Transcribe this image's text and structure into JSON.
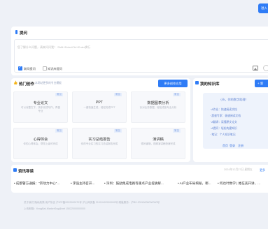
{
  "top": {
    "action_label": "进入"
  },
  "question": {
    "title": "提问",
    "placeholder": "您了解什么问题，请来问问我！ Shift+Enter/Ctrl+Enter换行",
    "options": [
      {
        "label": "联网提问",
        "checked": true
      },
      {
        "label": "知识库提问",
        "checked": false
      }
    ],
    "icons": [
      "image-icon",
      "circle-action-icon"
    ]
  },
  "hot": {
    "title": "热门创作",
    "subtitle": "本网站更多的专业模板",
    "more_label": "更多创作应用",
    "templates": [
      {
        "tag": "常见",
        "title": "专业论文",
        "desc": "可以对整文下，快手完成写作，再做专业"
      },
      {
        "tag": "常见",
        "title": "PPT",
        "desc": "一键快速生成，轻松完成PPT"
      },
      {
        "tag": "常见",
        "title": "数据图表分析",
        "desc": "针对业务数据，轻松成各专业分析"
      },
      {
        "tag": "常见",
        "title": "心得体会",
        "desc": "你的心得体会，帮您上级可完成"
      },
      {
        "tag": "常见",
        "title": "实习总结报告",
        "desc": "你的专业实习的实习总结报告完成"
      },
      {
        "tag": "常见",
        "title": "演讲稿",
        "desc": "很厉害哦，视频演讲稿快速完成"
      }
    ]
  },
  "kb": {
    "title": "我的知识库",
    "new_label": "+ 新",
    "greeting": "小k，你的数字助理！",
    "items": [
      "· A作业：快速阅读文档",
      "· 超速专家：极速阅读文档",
      "· A翻译：读懂原文论文",
      "· A提问：轻松构建知识",
      "· 笔记：个人知识笔记"
    ],
    "links": [
      "首页",
      "登录",
      "注册"
    ]
  },
  "news": {
    "title": "资讯导读",
    "date": "2024年12月27日 星期五",
    "more_label": "更多",
    "items": [
      "• 成都警方通报：\"宗动力中心\"...",
      "• 李强主持召开...",
      "• 深圳：鼓励集成电路等重点产业提质解...",
      "• AI产业布局揭秘，哪...",
      "• 何也叶数学 | 她在美开讲，..."
    ]
  },
  "footer": {
    "line1": "关于我们    隐私政策    用户协议    沪ICP备2022000070号    沪公网安备 31010402000000号    增值服务：沪B2-20240000000000号",
    "line2": "上传邮箱：KnsgBat-MarkerSng@net 15022000000000"
  }
}
